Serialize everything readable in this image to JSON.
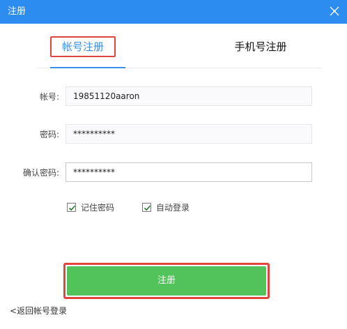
{
  "window": {
    "title": "注册",
    "close_icon": "close-icon"
  },
  "tabs": [
    {
      "label": "帐号注册",
      "active": true
    },
    {
      "label": "手机号注册",
      "active": false
    }
  ],
  "form": {
    "account_label": "帐号:",
    "account_value": "19851120aaron",
    "password_label": "密码:",
    "password_value": "**********",
    "confirm_label": "确认密码:",
    "confirm_value": "**********"
  },
  "options": {
    "remember_label": "记住密码",
    "remember_checked": true,
    "autologin_label": "自动登录",
    "autologin_checked": true
  },
  "actions": {
    "register_label": "注册",
    "back_label": "<返回帐号登录"
  },
  "colors": {
    "titlebar": "#2d8cf0",
    "active_tab": "#3a8ee6",
    "register_button": "#52c35b",
    "highlight_outline": "#e0463e"
  }
}
